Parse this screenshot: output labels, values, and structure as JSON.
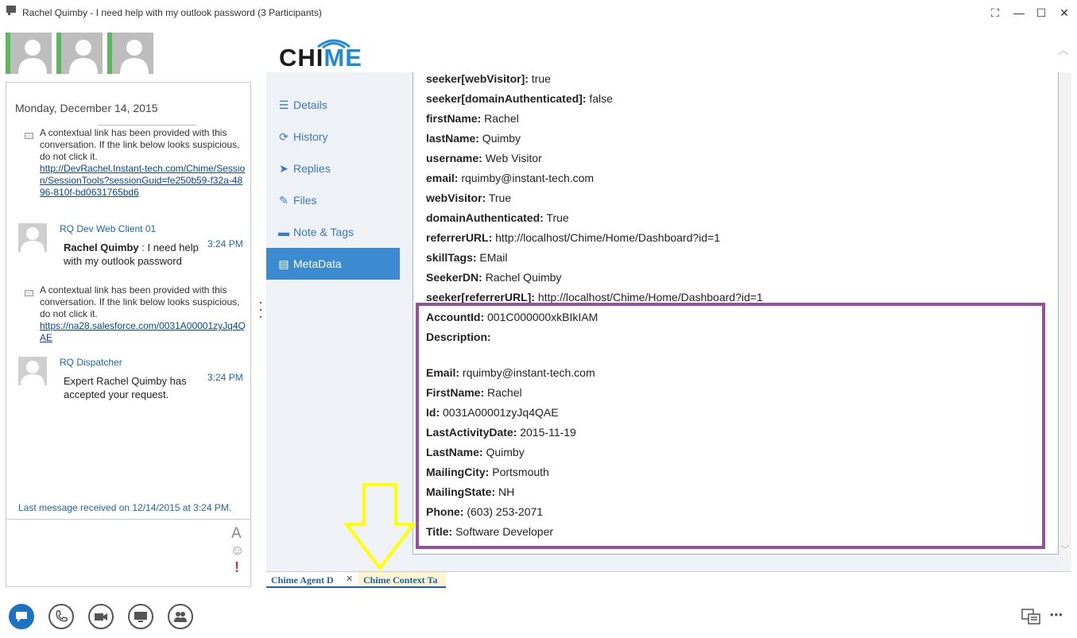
{
  "window": {
    "title": "Rachel Quimby - I need help with my outlook password (3 Participants)",
    "controls": {
      "restore": "⛶",
      "minimize": "—",
      "maximize": "☐",
      "close": "✕"
    }
  },
  "conversation": {
    "date": "Monday, December 14, 2015",
    "system_message_1": {
      "text": "A contextual link has been provided with this conversation. If the link below looks suspicious, do not click it.",
      "link": "http://DevRachel.Instant-tech.com/Chime/Session/SessionTools?sessionGuid=fe250b59-f32a-4896-810f-bd0631765bd6"
    },
    "message_1": {
      "sender": "RQ Dev Web Client 01",
      "author": "Rachel Quimby",
      "text": " : I need help with my outlook password",
      "time": "3:24 PM"
    },
    "system_message_2": {
      "text": "A contextual link has been provided with this conversation. If the link below looks suspicious, do not click it.",
      "link": "https://na28.salesforce.com/0031A00001zyJq4QAE"
    },
    "message_2": {
      "sender": "RQ Dispatcher",
      "text": "Expert Rachel Quimby has accepted your request.",
      "time": "3:24 PM"
    },
    "last_message": "Last message received on 12/14/2015 at 3:24 PM."
  },
  "compose": {
    "font_glyph": "A",
    "emoji_glyph": "☺",
    "important_glyph": "!"
  },
  "logo": {
    "text_1": "CHI",
    "text_2": "ME"
  },
  "sidenav": [
    {
      "label": "Details",
      "icon": "list-icon",
      "glyph": "☰"
    },
    {
      "label": "History",
      "icon": "history-icon",
      "glyph": "⟳"
    },
    {
      "label": "Replies",
      "icon": "send-icon",
      "glyph": "➤"
    },
    {
      "label": "Files",
      "icon": "paperclip-icon",
      "glyph": "✎"
    },
    {
      "label": "Note & Tags",
      "icon": "comment-icon",
      "glyph": "▬"
    },
    {
      "label": "MetaData",
      "icon": "table-icon",
      "glyph": "▤"
    }
  ],
  "metadata": [
    {
      "key": "seeker[webVisitor]:",
      "value": " true"
    },
    {
      "key": "seeker[domainAuthenticated]:",
      "value": " false"
    },
    {
      "key": "firstName:",
      "value": " Rachel"
    },
    {
      "key": "lastName:",
      "value": " Quimby"
    },
    {
      "key": "username:",
      "value": " Web Visitor"
    },
    {
      "key": "email:",
      "value": " rquimby@instant-tech.com"
    },
    {
      "key": "webVisitor:",
      "value": " True"
    },
    {
      "key": "domainAuthenticated:",
      "value": " True"
    },
    {
      "key": "referrerURL:",
      "value": " http://localhost/Chime/Home/Dashboard?id=1"
    },
    {
      "key": "skillTags:",
      "value": " EMail"
    },
    {
      "key": "SeekerDN:",
      "value": " Rachel Quimby"
    },
    {
      "key": "seeker[referrerURL]:",
      "value": " http://localhost/Chime/Home/Dashboard?id=1"
    },
    {
      "key": "AccountId:",
      "value": " 001C000000xkBIkIAM"
    },
    {
      "key": "Description:",
      "value": ""
    },
    {
      "key": "Email:",
      "value": " rquimby@instant-tech.com"
    },
    {
      "key": "FirstName:",
      "value": " Rachel"
    },
    {
      "key": "Id:",
      "value": " 0031A00001zyJq4QAE"
    },
    {
      "key": "LastActivityDate:",
      "value": " 2015-11-19"
    },
    {
      "key": "LastName:",
      "value": " Quimby"
    },
    {
      "key": "MailingCity:",
      "value": " Portsmouth"
    },
    {
      "key": "MailingState:",
      "value": " NH"
    },
    {
      "key": "Phone:",
      "value": " (603) 253-2071"
    },
    {
      "key": "Title:",
      "value": " Software Developer"
    }
  ],
  "tabs": {
    "agent_tab": "Chime Agent D",
    "context_tab": "Chime Context Ta",
    "close_glyph": "✕"
  },
  "colors": {
    "accent": "#3c8ad0",
    "highlight_border": "#9b4da4",
    "arrow": "#ffff00",
    "presence": "#5cb85c"
  },
  "toolbar": {
    "more_glyph": "•••"
  }
}
